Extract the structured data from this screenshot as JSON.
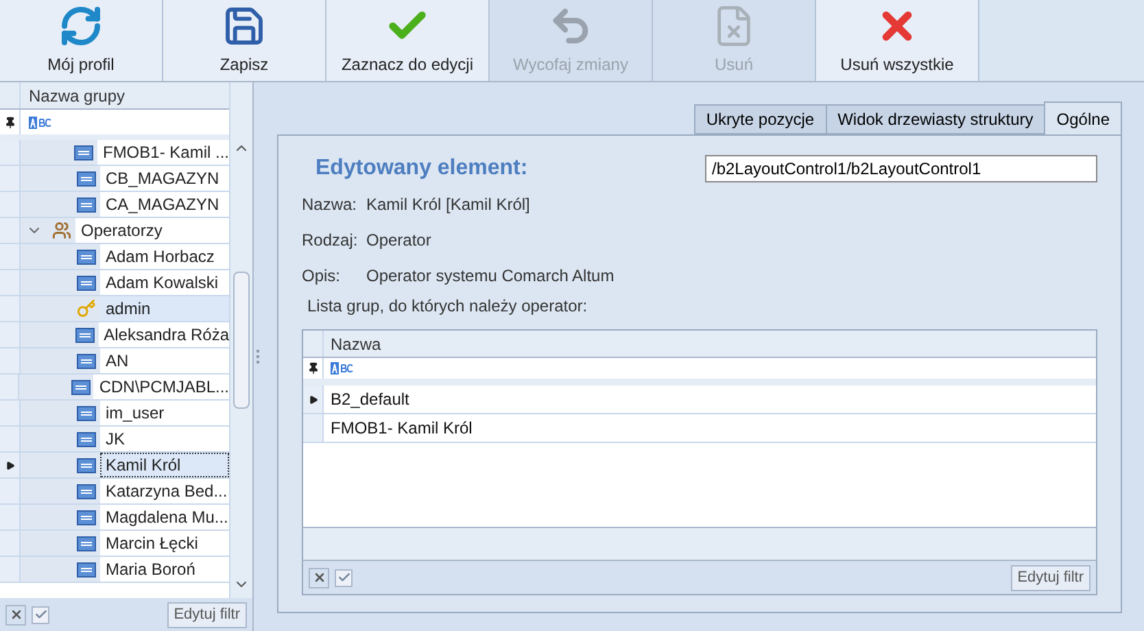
{
  "toolbar": [
    {
      "label": "Mój profil",
      "kind": "refresh",
      "disabled": false
    },
    {
      "label": "Zapisz",
      "kind": "save",
      "disabled": false
    },
    {
      "label": "Zaznacz do edycji",
      "kind": "check",
      "disabled": false
    },
    {
      "label": "Wycofaj zmiany",
      "kind": "undo",
      "disabled": true
    },
    {
      "label": "Usuń",
      "kind": "delete",
      "disabled": true
    },
    {
      "label": "Usuń wszystkie",
      "kind": "remove-all",
      "disabled": false
    }
  ],
  "tree": {
    "column": "Nazwa grupy",
    "items": [
      {
        "label": "FMOB1- Kamil ...",
        "kind": "list",
        "selected": false
      },
      {
        "label": "CB_MAGAZYN",
        "kind": "list",
        "selected": false
      },
      {
        "label": "CA_MAGAZYN",
        "kind": "list",
        "selected": false
      },
      {
        "label": "Operatorzy",
        "kind": "group",
        "selected": false,
        "expanded": true,
        "children": [
          {
            "label": "Adam Horbacz",
            "kind": "list",
            "selected": false
          },
          {
            "label": "Adam Kowalski",
            "kind": "list",
            "selected": false
          },
          {
            "label": "admin",
            "kind": "key",
            "selected": false,
            "highlighted": true
          },
          {
            "label": "Aleksandra Róża",
            "kind": "list",
            "selected": false
          },
          {
            "label": "AN",
            "kind": "list",
            "selected": false
          },
          {
            "label": "CDN\\PCMJABL...",
            "kind": "list",
            "selected": false
          },
          {
            "label": "im_user",
            "kind": "list",
            "selected": false
          },
          {
            "label": "JK",
            "kind": "list",
            "selected": false
          },
          {
            "label": "Kamil Król",
            "kind": "list",
            "selected": true
          },
          {
            "label": "Katarzyna Bed...",
            "kind": "list",
            "selected": false
          },
          {
            "label": "Magdalena Mu...",
            "kind": "list",
            "selected": false
          },
          {
            "label": "Marcin Łęcki",
            "kind": "list",
            "selected": false
          },
          {
            "label": "Maria Boroń",
            "kind": "list",
            "selected": false
          }
        ]
      }
    ],
    "filter_button": "Edytuj filtr"
  },
  "tabs": [
    {
      "label": "Ukryte pozycje",
      "selected": false
    },
    {
      "label": "Widok drzewiasty struktury",
      "selected": false
    },
    {
      "label": "Ogólne",
      "selected": true
    }
  ],
  "details": {
    "heading": "Edytowany element:",
    "path": "/b2LayoutControl1/b2LayoutControl1",
    "fields": [
      {
        "label": "Nazwa:",
        "value": "Kamil Król [Kamil Król]"
      },
      {
        "label": "Rodzaj:",
        "value": "Operator"
      },
      {
        "label": "Opis:",
        "value": "Operator systemu Comarch Altum"
      }
    ],
    "list_label": "Lista grup, do których należy operator:"
  },
  "groups_table": {
    "column": "Nazwa",
    "rows": [
      {
        "name": "B2_default",
        "selected": true
      },
      {
        "name": "FMOB1- Kamil Król",
        "selected": false
      }
    ],
    "filter_button": "Edytuj filtr"
  }
}
